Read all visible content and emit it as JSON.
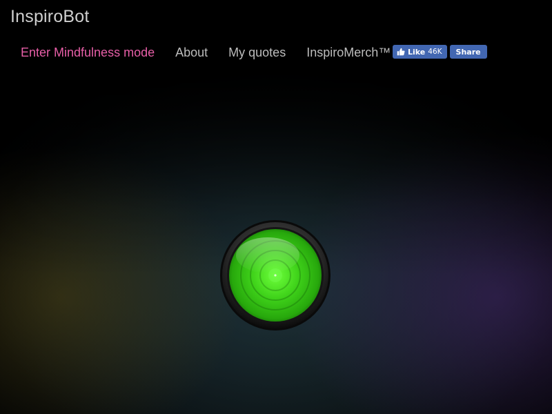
{
  "site": {
    "title": "InspiroBot"
  },
  "nav": {
    "items": [
      {
        "label": "Enter Mindfulness mode",
        "accent": true
      },
      {
        "label": "About"
      },
      {
        "label": "My quotes"
      },
      {
        "label": "InspiroMerch™"
      }
    ]
  },
  "facebook": {
    "like_label": "Like",
    "like_count": "46K",
    "share_label": "Share",
    "color": "#4267b2"
  },
  "colors": {
    "accent": "#e85fa8",
    "nav_text": "#bdbdbd",
    "button_green": "#3fd21a"
  },
  "main_button": {
    "icon": "green-generate-button-icon"
  }
}
